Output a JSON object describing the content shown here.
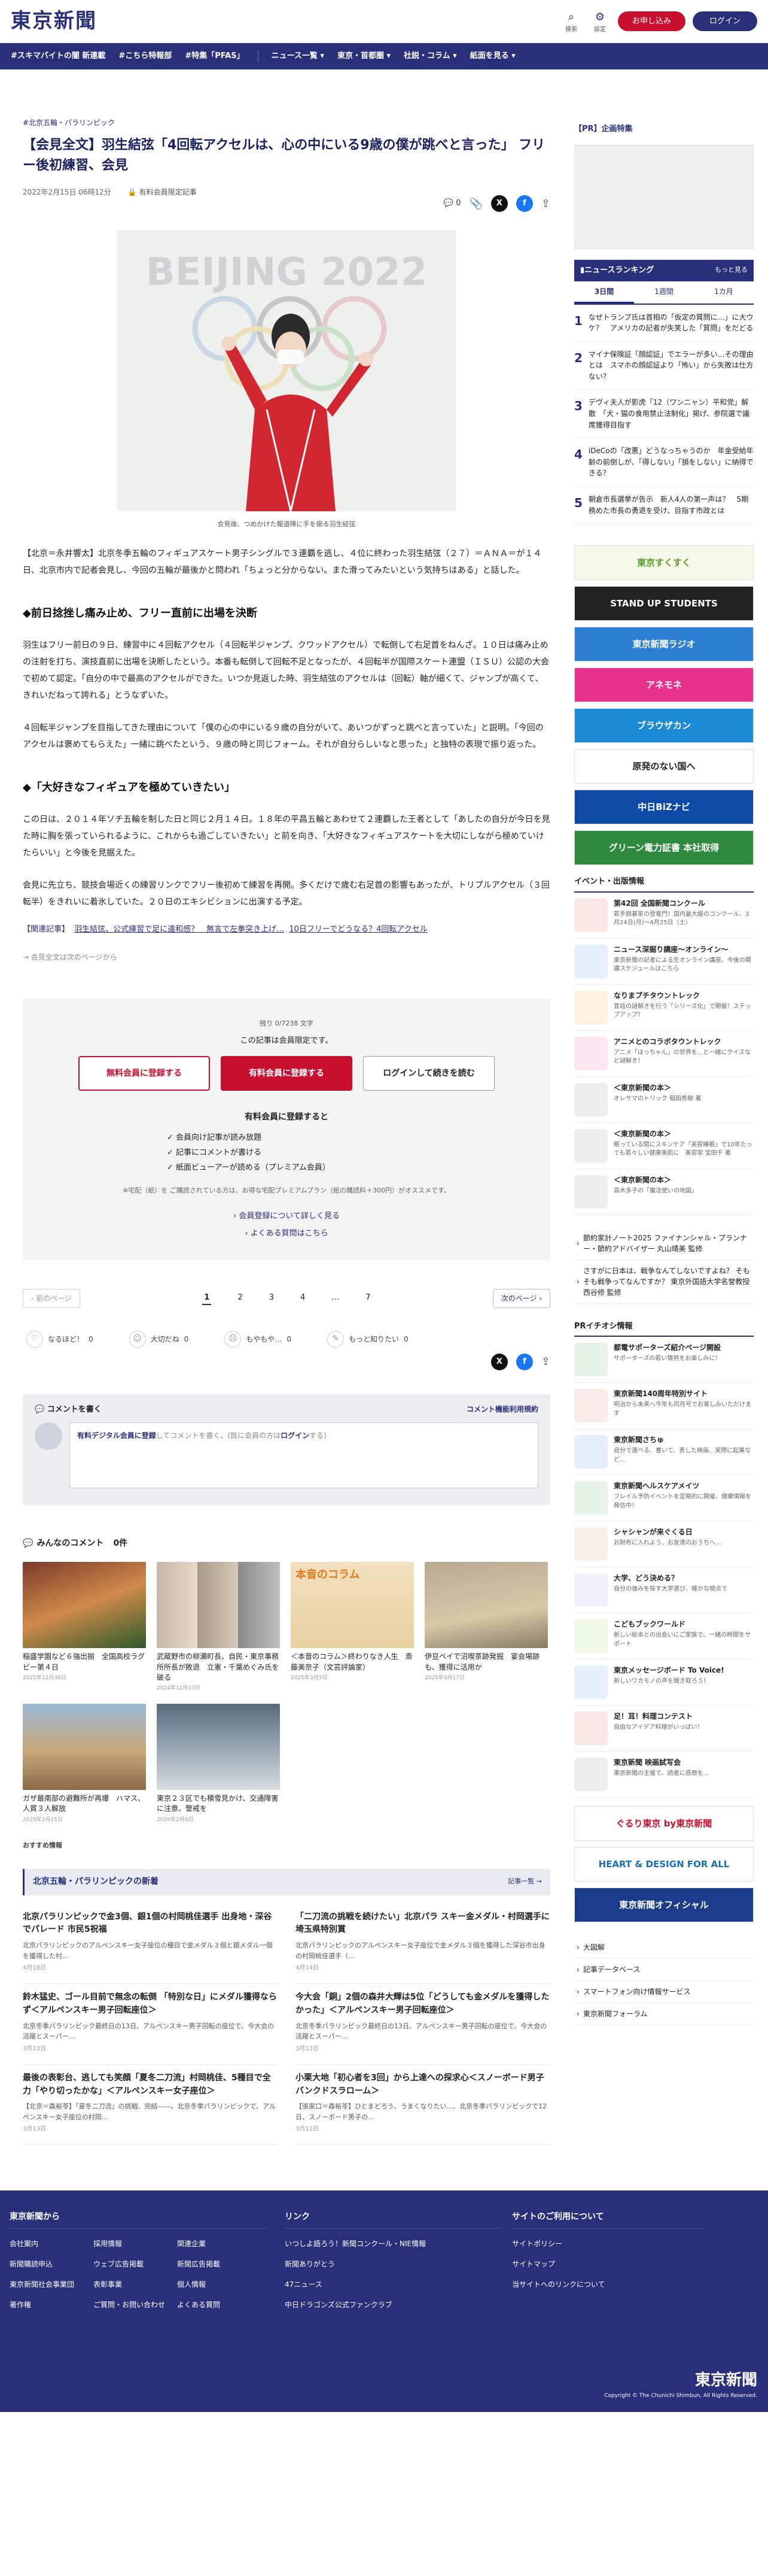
{
  "header": {
    "logo": "東京新聞",
    "search_label": "検索",
    "settings_label": "設定",
    "register_label": "お申し込み",
    "login_label": "ログイン"
  },
  "nav": [
    "#スキマバイトの闇 新連載",
    "#こちら特報部",
    "#特集「PFAS」",
    "ニュース一覧 ▾",
    "東京・首都圏 ▾",
    "社説・コラム ▾",
    "紙面を見る ▾"
  ],
  "breadcrumb": [
    "#北京五輪・パラリンピック"
  ],
  "article": {
    "title": "【会見全文】羽生結弦「4回転アクセルは、心の中にいる9歳の僕が跳べと言った」 フリー後初練習、会見",
    "date": "2022年2月15日 06時12分",
    "lock_label": "有料会員限定記事",
    "comment_count": "0",
    "photo_text": "BEIJING 2022",
    "caption": "会見後、つめかけた報道陣に手を振る羽生結弦",
    "lead": "【北京＝永井響太】北京冬季五輪のフィギュアスケート男子シングルで３連覇を逃し、４位に終わった羽生結弦（２７）＝ＡＮＡ＝が１４日、北京市内で記者会見し、今回の五輪が最後かと問われ「ちょっと分からない。また滑ってみたいという気持ちはある」と話した。",
    "h2_1": "◆前日捻挫し痛み止め、フリー直前に出場を決断",
    "p1": "羽生はフリー前日の９日、練習中に４回転アクセル（４回転半ジャンプ、クワッドアクセル）で転倒して右足首をねんざ。１０日は痛み止めの注射を打ち、演技直前に出場を決断したという。本番も転倒して回転不足となったが、４回転半が国際スケート連盟（ＩＳＵ）公認の大会で初めて認定。「自分の中で最高のアクセルができた。いつか見返した時、羽生結弦のアクセルは（回転）軸が細くて、ジャンプが高くて、きれいだねって誇れる」とうなずいた。",
    "p2": "４回転半ジャンプを目指してきた理由について「僕の心の中にいる９歳の自分がいて、あいつがずっと跳べと言っていた」と説明。「今回のアクセルは褒めてもらえた」一緒に跳べたという、９歳の時と同じフォーム。それが自分らしいなと思った」と独特の表現で振り返った。",
    "h2_2": "◆「大好きなフィギュアを極めていきたい」",
    "p3": "この日は、２０１４年ソチ五輪を制した日と同じ２月１４日。１８年の平昌五輪とあわせて２連覇した王者として「あしたの自分が今日を見た時に胸を張っていられるように、これからも過ごしていきたい」と前を向き、「大好きなフィギュアスケートを大切にしながら極めていけたらいい」と今後を見据えた。",
    "p4": "会見に先立ち、競技会場近くの練習リンクでフリー後初めて練習を再開。多くだけで歳む右足首の影響もあったが、トリプルアクセル（３回転半）をきれいに着氷していた。２０日のエキシビションに出演する予定。",
    "related_label": "【関連記事】",
    "related_links": [
      "羽生結弦、公式練習で足に違和感？　無言で左拳突き上げ…",
      "10日フリーでどうなる？4回転アクセル"
    ],
    "continue": "会見全文は次のページから"
  },
  "paywall": {
    "remaining": "残り 0/7238 文字",
    "limited": "この記事は会員限定です。",
    "btn_free": "無料会員に登録する",
    "btn_paid": "有料会員に登録する",
    "btn_login": "ログインして続きを読む",
    "benefits_title": "有料会員に登録すると",
    "benefits": [
      "会員向け記事が読み放題",
      "記事にコメントが書ける",
      "紙面ビューアーが読める（プレミアム会員）"
    ],
    "note": "※宅配（紙）を ご購読されている方は、お得な宅配プレミアムプラン（紙の購読料＋300円）がオススメです。",
    "link1": "会員登録について詳しく見る",
    "link2": "よくある質問はこちら"
  },
  "pager": {
    "prev": "前のページ",
    "next": "次のページ",
    "pages": [
      "1",
      "2",
      "3",
      "4",
      "…",
      "7"
    ],
    "current": "1"
  },
  "reactions": [
    {
      "icon": "♡",
      "label": "なるほど！",
      "count": "0"
    },
    {
      "icon": "☺",
      "label": "大切だね",
      "count": "0"
    },
    {
      "icon": "☹",
      "label": "もやもや…",
      "count": "0"
    },
    {
      "icon": "✎",
      "label": "もっと知りたい",
      "count": "0"
    }
  ],
  "comment_box": {
    "title": "コメントを書く",
    "rules": "コメント機能利用規約",
    "prompt_a": "有料デジタル会員に登録",
    "prompt_b": "してコメントを書く。(既に会員の方は",
    "prompt_c": "ログイン",
    "prompt_d": "する)"
  },
  "member_comments": {
    "title": "みんなのコメント",
    "count": "0件",
    "items": [
      {
        "title": "稲盛学園など６強出揃　全国高校ラグビー第４日",
        "date": "2025年12月30日"
      },
      {
        "title": "武蔵野市の柳瀬町長、自民・東京事務所所長が敗退　立憲・千葉めぐみ氏を破る",
        "date": "2024年12月17日"
      },
      {
        "title": "＜本音のコラム＞終わりなき人生　斎藤美奈子（文芸評論家）",
        "date": "2025年3月5日"
      },
      {
        "title": "伊豆ペイで沼喫茶跡発掘　宴会場跡も、獲得に活用か",
        "date": "2025年9月17日"
      },
      {
        "title": "ガザ最南部の避難所が再爆　ハマス、人質３人解放",
        "date": "2025年2月15日"
      },
      {
        "title": "東京２３区でも積雪見かけ、交通障害に注意、警戒を",
        "date": "2026年2月8日"
      }
    ]
  },
  "recommend_label": "おすすめ情報",
  "news_section": {
    "title": "北京五輪・パラリンピックの新着",
    "more": "記事一覧 →",
    "items": [
      {
        "h": "北京パラリンピックで金3個、銀1個の村岡桃佳選手 出身地・深谷でパレード 市民5祝福",
        "x": "北京パラリンピックのアルペンスキー女子座位の種目で金メダル３個と銀メダル一個を獲得した村...",
        "d": "4月18日"
      },
      {
        "h": "「二刀流の挑戦を続けたい」北京パラ スキー金メダル・村岡選手に埼玉県特別賞",
        "x": "北京パラリンピックのアルペンスキー女子座位で金メダル３個を獲得した深谷市出身の村岡桃佳選手（...",
        "d": "4月14日"
      },
      {
        "h": "鈴木猛史、ゴール目前で無念の転倒 「特別な日」にメダル獲得ならず＜アルペンスキー男子回転座位＞",
        "x": "北京冬季パラリンピック最終日の13日、アルペンスキー男子回転の座位で、今大会の活躍とスーパー...",
        "d": "3月13日"
      },
      {
        "h": "今大会「銅」2個の森井大輝は5位「どうしても金メダルを獲得したかった」＜アルペンスキー男子回転座位＞",
        "x": "北京冬季パラリンピック最終日の13日、アルペンスキー男子回転の座位で、今大会の活躍とスーパー...",
        "d": "3月13日"
      },
      {
        "h": "最後の表彰台、逃しても笑顔「夏冬二刀流」村岡桃佳、5種目で全力「やり切ったかな」＜アルペンスキー女子座位＞",
        "x": "【北京＝森裕苓】「夏冬二刀流」の挑戦、完結――。北京冬季パラリンピックで、アルペンスキー女子座位の村岡...",
        "d": "3月13日"
      },
      {
        "h": "小栗大地「初心者を3回」から上達への探求心＜スノーボード男子バンクドスラローム＞",
        "x": "【張家口＝森裕苓】ひとまどろう、うまくなりたい...、北京冬季パラリンピックで12日、スノーボード男子の...",
        "d": "3月12日"
      }
    ]
  },
  "sidebar": {
    "pr_title": "【PR】企画特集",
    "ranking_title": "ニュースランキング",
    "ranking_more": "もっと見る",
    "tabs": [
      "3日間",
      "1週間",
      "1カ月"
    ],
    "ranking": [
      "なぜトランプ氏は首相の「仮定の質問に…」に大ウケ？　アメリカの記者が失笑した「質問」をだどる",
      "マイナ保険証「顔認証」でエラーが多い…その理由とは　スマホの顔認証より「怖い」から失敗は仕方ない？",
      "デヴィ夫人が影虎「12（ワンニャン）平和党」解散　「犬・猫の食用禁止法制化」掲げ、参院選で議席獲得目指す",
      "iDeCoの「改悪」どうなっちゃうのか　年金受給年齢の前倒しが、「得しない」「損をしない」に納得できる？",
      "朝倉市長選挙が告示　新人4人の第一声は？　5期務めた市長の勇退を受け、目指す市政とは"
    ],
    "banners": [
      {
        "text": "東京すくすく",
        "bg": "#f4f9e8",
        "fg": "#5b9a2a"
      },
      {
        "text": "STAND UP STUDENTS",
        "bg": "#222222",
        "fg": "#ffffff"
      },
      {
        "text": "東京新聞ラジオ",
        "bg": "#2d7fd3",
        "fg": "#ffffff"
      },
      {
        "text": "アネモネ",
        "bg": "#e8318a",
        "fg": "#ffffff"
      },
      {
        "text": "ブラウザカン",
        "bg": "#1b8bd6",
        "fg": "#ffffff"
      },
      {
        "text": "原発のない国へ",
        "bg": "#ffffff",
        "fg": "#222222"
      },
      {
        "text": "中日BiZナビ",
        "bg": "#0d4aa6",
        "fg": "#ffffff"
      },
      {
        "text": "グリーン電力証書 本社取得",
        "bg": "#2f8a3d",
        "fg": "#ffffff"
      }
    ],
    "events_title": "イベント・出版情報",
    "events": [
      {
        "t": "第42回 全国新聞コンクール",
        "x": "若手囲碁家の登竜門！国内最大級のコンクール、3月24日(月)〜4月25日（土）",
        "c": "#fbe6e6"
      },
      {
        "t": "ニュース深掘り講座〜オンライン〜",
        "x": "東京新聞の記者による生オンライン講座。今後の開講スケジュールはこちら",
        "c": "#e6f0fb"
      },
      {
        "t": "なりまプチタウントレック",
        "x": "昔話の謎解きを行う「シリーズ化」で開催！ステップアップ！",
        "c": "#fdf2e0"
      },
      {
        "t": "アニメとのコラボタウントレック",
        "x": "アニメ「はっちゃん」の世界を...と一緒にクイズなど謎解き！",
        "c": "#fbe6f2"
      },
      {
        "t": "＜東京新聞の本＞",
        "x": "オレサマのトリック 稲田秀樹 著",
        "c": "#eeeeee"
      },
      {
        "t": "＜東京新聞の本＞",
        "x": "眠っている間にスキンケア「美容睡眠」で10年たっても若々しい健康美肌に　美容家 宝田千 著",
        "c": "#eeeeee"
      },
      {
        "t": "＜東京新聞の本＞",
        "x": "高木多子の「魔法使いの地図」",
        "c": "#eeeeee"
      }
    ],
    "text_links": [
      "節約家計ノート2025 ファイナンシャル・プランナー・節約アドバイザー 丸山晴美 監修",
      "さすがに日本は、戦争なんてしないですよね？ そもそも戦争ってなんですか？ 東京外国語大学名誉教授 西谷修 監修"
    ],
    "pr_info_title": "PRイチオシ情報",
    "pr_info": [
      {
        "t": "都電サポーターズ紹介ページ開設",
        "x": "サポーターズの若い情熱をお楽しみに！",
        "c": "#e6f3e6"
      },
      {
        "t": "東京新聞140周年特別サイト",
        "x": "明治から未来へ今年も同月号でお楽しみいただけます",
        "c": "#fbeaea"
      },
      {
        "t": "東京新聞さちゅ",
        "x": "自分で選べる、書いて、表した映画、実際に起業など...",
        "c": "#e6eef9"
      },
      {
        "t": "東京新聞ヘルスケアメイツ",
        "x": "フレイル予防イベントを定期的に開催、健康情報を発信中！",
        "c": "#e6f3e6"
      },
      {
        "t": "シャシャンが来ぐくる日",
        "x": "お財布に入れよう、お友達のおうちへ...",
        "c": "#f8f0e6"
      },
      {
        "t": "大学、どう決める？",
        "x": "自分の強みを探す大学選び、確かな視点で",
        "c": "#eef1fb"
      },
      {
        "t": "こどもブックワールド",
        "x": "新しい絵本との出会いにご家族で、一緒の時間をサポート",
        "c": "#f0f9e6"
      },
      {
        "t": "東京メッセージボード To Voice!",
        "x": "新しいワカモノの声を聞き取ろう！",
        "c": "#e6f0fb"
      },
      {
        "t": "足！耳！料理コンテスト",
        "x": "自由なアイデア料理がいっぱい！",
        "c": "#fbe6e6"
      },
      {
        "t": "東京新聞 映画試写会",
        "x": "東京新聞の主催で、読者に感想を...",
        "c": "#eeeeee"
      }
    ],
    "banners2": [
      {
        "text": "ぐるり東京 by東京新聞",
        "bg": "#ffffff",
        "fg": "#c8102e"
      },
      {
        "text": "HEART & DESIGN FOR ALL",
        "bg": "#ffffff",
        "fg": "#1b6fb8"
      },
      {
        "text": "東京新聞オフィシャル",
        "bg": "#1b3c8a",
        "fg": "#ffffff"
      }
    ],
    "side_links": [
      "大図解",
      "記事データベース",
      "スマートフォン向け情報サービス",
      "東京新聞フォーラム"
    ]
  },
  "footer": {
    "col1_title": "東京新聞から",
    "col1": [
      "会社案内",
      "採用情報",
      "関連企業",
      "新聞購読申込",
      "ウェブ広告掲載",
      "新聞広告掲載",
      "東京新聞社会事業団",
      "表彰事業",
      "個人情報",
      "著作権",
      "ご質問・お問い合わせ",
      "よくある質問"
    ],
    "col2_title": "リンク",
    "col2": [
      "いつしよ語ろう！新聞コンクール・NIE情報",
      "新聞ありがとう",
      "47ニュース",
      "中日ドラゴンズ公式ファンクラブ"
    ],
    "col3_title": "サイトのご利用について",
    "col3": [
      "サイトポリシー",
      "サイトマップ",
      "当サイトへのリンクについて"
    ],
    "logo": "東京新聞",
    "copyright": "Copyright © The Chunichi Shimbun, All Rights Reserved."
  }
}
